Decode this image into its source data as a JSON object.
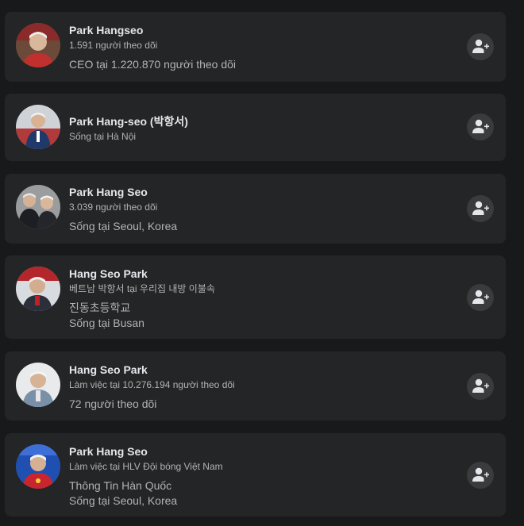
{
  "results": [
    {
      "name": "Park Hangseo",
      "subtitle": "1.591 người theo dõi",
      "details": [
        "CEO tại 1.220.870 người theo dõi"
      ]
    },
    {
      "name": "Park Hang-seo (박항서)",
      "subtitle": "Sống tại Hà Nội",
      "details": []
    },
    {
      "name": "Park Hang Seo",
      "subtitle": "3.039 người theo dõi",
      "details": [
        "Sống tại Seoul, Korea"
      ]
    },
    {
      "name": "Hang Seo Park",
      "subtitle": "베트남 박항서 tại 우리집 내방 이불속",
      "details": [
        "진동초등학교",
        "Sống tại Busan"
      ]
    },
    {
      "name": "Hang Seo Park",
      "subtitle": "Làm việc tại 10.276.194 người theo dõi",
      "details": [
        "72 người theo dõi"
      ]
    },
    {
      "name": "Park Hang Seo",
      "subtitle": "Làm việc tại HLV Đội bóng Việt Nam",
      "details": [
        "Thông Tin Hàn Quốc",
        "Sống tại Seoul, Korea"
      ]
    }
  ],
  "icons": {
    "add_friend": "add-friend-icon",
    "avatar": "profile-photo"
  },
  "colors": {
    "background": "#18191a",
    "card": "#242526",
    "button": "#3a3b3c",
    "primary_text": "#e4e6eb",
    "secondary_text": "#b0b3b8"
  }
}
